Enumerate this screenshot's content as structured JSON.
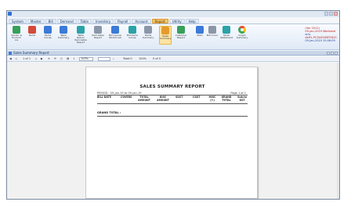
{
  "menu": [
    "System",
    "Master",
    "Bill",
    "Demand",
    "Table",
    "Inventory",
    "Payroll",
    "Account",
    "Report",
    "Utility",
    "Help"
  ],
  "menu_active_index": 8,
  "ribbon": {
    "buttons": [
      {
        "label": "Vendor & Product Lis",
        "icon": "user-icon"
      },
      {
        "label": "Items",
        "icon": "calendar-icon"
      },
      {
        "label": "Items Group",
        "icon": "folder-icon"
      },
      {
        "label": "Table Summary",
        "icon": "folder-icon"
      },
      {
        "label": "Table Return Item-table Report",
        "icon": "folder-icon"
      },
      {
        "label": "Item-table Report",
        "icon": "car-icon"
      },
      {
        "label": "Bill Cancel Month List",
        "icon": "document-icon"
      },
      {
        "label": "Bill Items Group",
        "icon": "folder-icon"
      },
      {
        "label": "Items Summary",
        "icon": "sigma-icon"
      },
      {
        "label": "Sales Summary",
        "icon": "money-icon"
      },
      {
        "label": "Customer Report",
        "icon": "user-icon"
      },
      {
        "label": "Start",
        "icon": "monitor-icon"
      },
      {
        "label": "Bill Cover",
        "icon": "document-icon"
      },
      {
        "label": "Stock Statement",
        "icon": "table-icon"
      },
      {
        "label": "Graph Summary",
        "icon": "chart-ring-icon"
      }
    ],
    "info_lines": [
      "(Ver 2011)",
      "09-Jan-2019 Wednesd",
      "shiv",
      "delFL.PC3A52D9FED2C",
      "09-Jan-2019 15:06:09"
    ]
  },
  "doc_window_title": "Sales Summary Report",
  "toolbar": {
    "page_indicator": "1 of 1",
    "zoom": "100%",
    "total_label": "Total:0",
    "percent_label": "100%",
    "value_label": "0 of 0"
  },
  "report": {
    "title": "SALES SUMMARY REPORT",
    "period": "PERIOD : 09-Jan-19 to 09-Jan-19",
    "page": "Page 1 of 1",
    "columns": [
      "BILL DATE",
      "COVERS",
      "TOTAL AMOUNT",
      "DISC AMOUNT",
      "SGST",
      "CGST",
      "MISC (+)",
      "GRAND TOTAL",
      "Sub.to GST"
    ],
    "grand_total_label": "GRAND TOTAL  :"
  },
  "colors": {
    "menu_active": "#f7c66b",
    "ribbon_info_text": "#c01818",
    "highlighted_button": "#fbe3a4"
  }
}
